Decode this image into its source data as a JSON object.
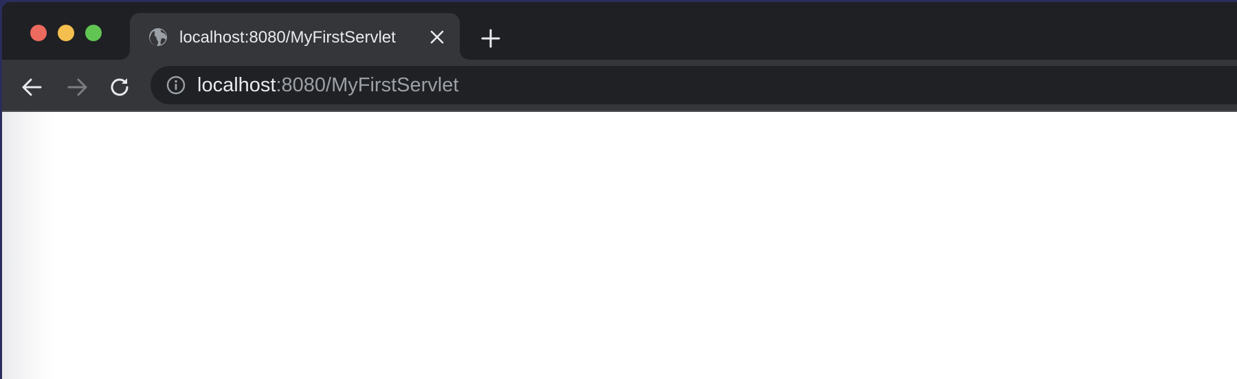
{
  "window": {
    "traffic_lights": [
      "close",
      "minimize",
      "maximize"
    ]
  },
  "tab": {
    "title": "localhost:8080/MyFirstServlet",
    "favicon": "globe-icon",
    "close_icon": "close-icon"
  },
  "new_tab": {
    "icon": "plus-icon"
  },
  "toolbar": {
    "back_icon": "arrow-left-icon",
    "forward_icon": "arrow-right-icon",
    "reload_icon": "reload-icon"
  },
  "address_bar": {
    "info_icon": "info-icon",
    "host": "localhost",
    "rest": ":8080/MyFirstServlet"
  },
  "colors": {
    "traffic_close": "#ec6a5e",
    "traffic_minimize": "#f4bf4f",
    "traffic_maximize": "#61c554",
    "tabstrip_bg": "#1f2024",
    "active_tab_bg": "#35363a",
    "omnibox_bg": "#202124",
    "url_host": "#e8eaed",
    "url_rest": "#9aa0a6",
    "content_bg": "#ffffff"
  }
}
